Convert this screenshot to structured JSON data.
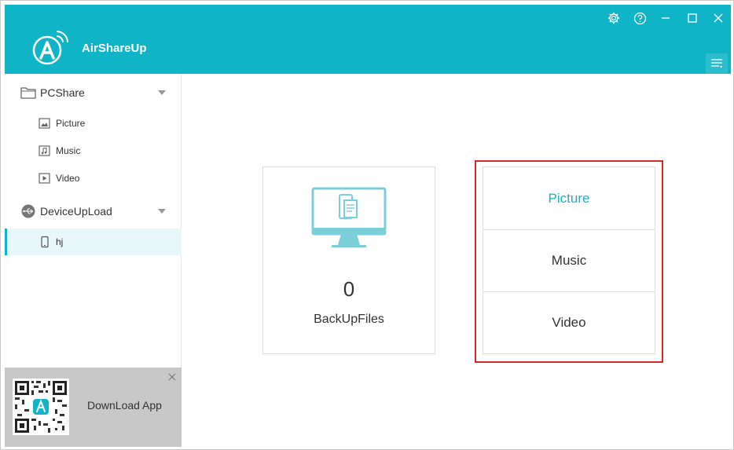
{
  "app": {
    "title": "AirShareUp",
    "accent_color": "#0fb4c6",
    "highlight_color": "#d9262c"
  },
  "window_controls": [
    "gear-icon",
    "help-icon",
    "minimize-icon",
    "maximize-icon",
    "close-icon"
  ],
  "sidebar": {
    "groups": [
      {
        "label": "PCShare",
        "icon": "folder-icon",
        "items": [
          {
            "label": "Picture",
            "icon": "picture-icon"
          },
          {
            "label": "Music",
            "icon": "music-icon"
          },
          {
            "label": "Video",
            "icon": "video-icon"
          }
        ]
      },
      {
        "label": "DeviceUpLoad",
        "icon": "usb-icon",
        "items": [
          {
            "label": "hj",
            "icon": "phone-icon",
            "selected": true
          }
        ]
      }
    ],
    "download": {
      "label": "DownLoad App"
    }
  },
  "main": {
    "backup": {
      "count": "0",
      "label": "BackUpFiles"
    },
    "types": [
      {
        "label": "Picture",
        "active": true
      },
      {
        "label": "Music",
        "active": false
      },
      {
        "label": "Video",
        "active": false
      }
    ]
  }
}
